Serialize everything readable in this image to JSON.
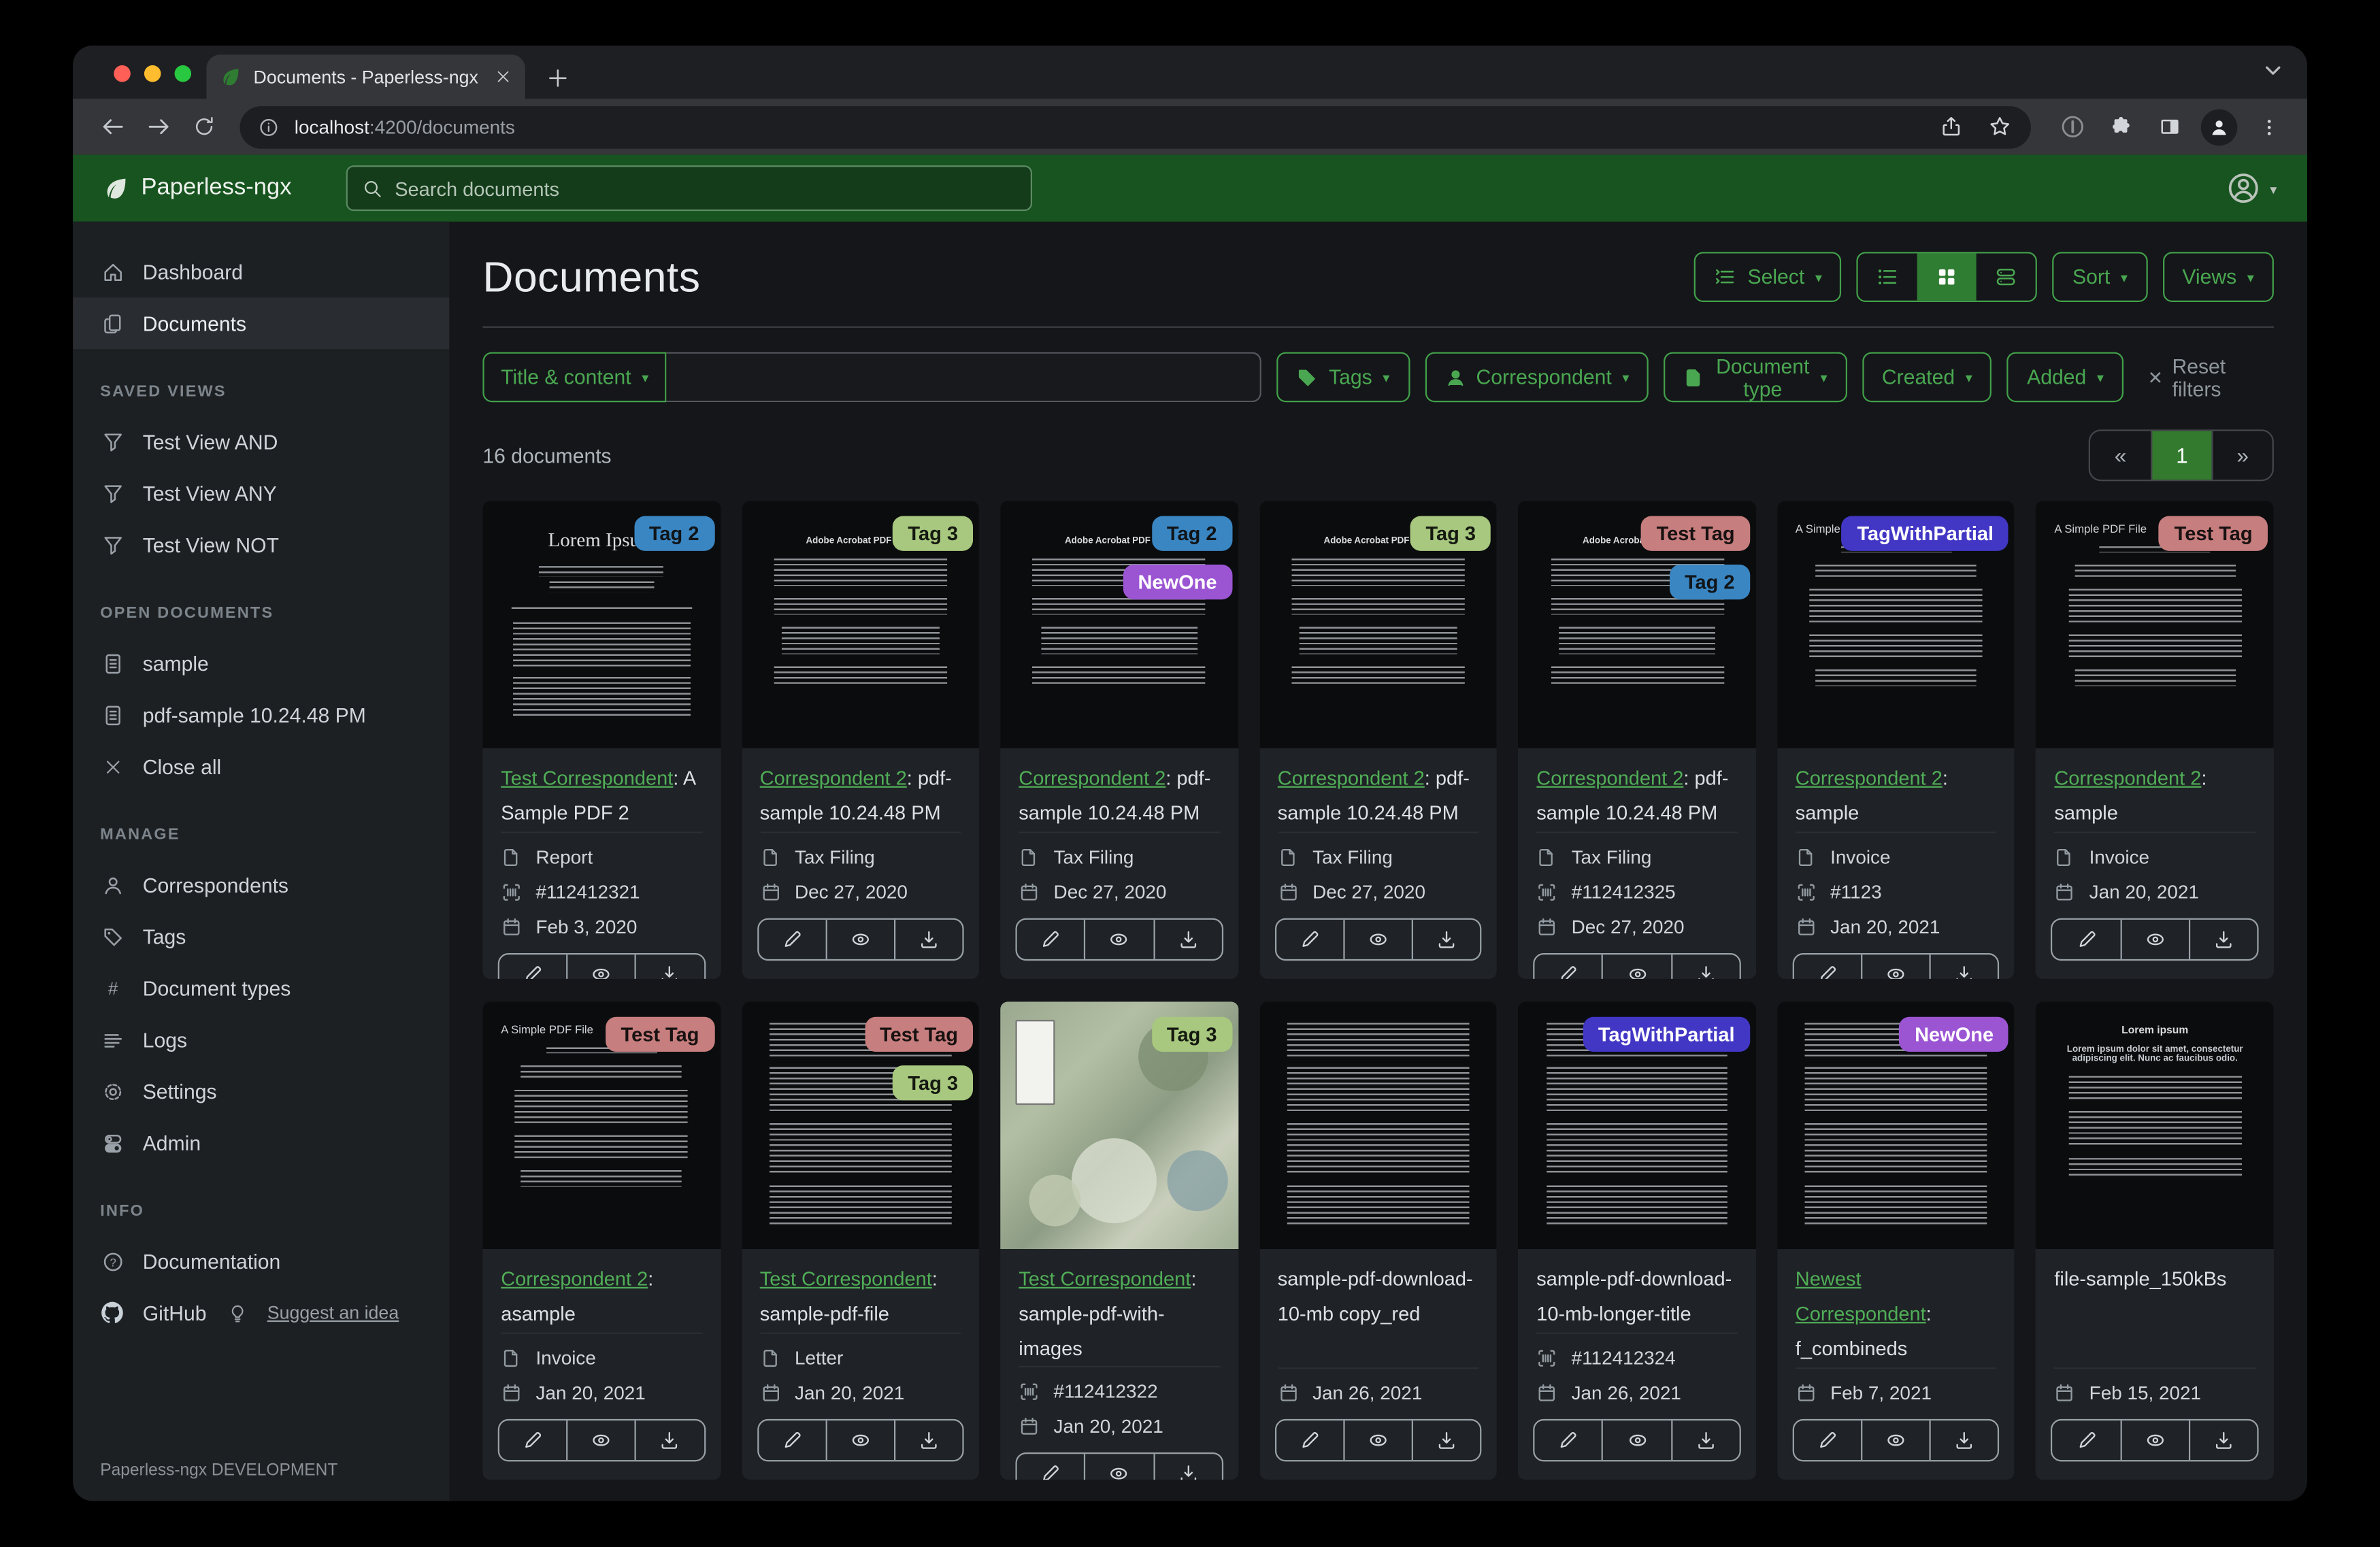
{
  "browser": {
    "tab_title": "Documents - Paperless-ngx",
    "url_host": "localhost",
    "url_path": ":4200/documents"
  },
  "header": {
    "app_name": "Paperless-ngx",
    "search_placeholder": "Search documents"
  },
  "sidebar": {
    "nav": [
      {
        "label": "Dashboard"
      },
      {
        "label": "Documents"
      }
    ],
    "saved_views_heading": "SAVED VIEWS",
    "saved_views": [
      "Test View AND",
      "Test View ANY",
      "Test View NOT"
    ],
    "open_documents_heading": "OPEN DOCUMENTS",
    "open_documents": [
      "sample",
      "pdf-sample 10.24.48 PM"
    ],
    "close_all": "Close all",
    "manage_heading": "MANAGE",
    "manage": [
      "Correspondents",
      "Tags",
      "Document types",
      "Logs",
      "Settings",
      "Admin"
    ],
    "info_heading": "INFO",
    "documentation": "Documentation",
    "github": "GitHub",
    "suggest_idea": "Suggest an idea",
    "footer": "Paperless-ngx DEVELOPMENT"
  },
  "page": {
    "title": "Documents",
    "select_label": "Select",
    "sort_label": "Sort",
    "views_label": "Views",
    "count": "16 documents",
    "pagination": [
      "«",
      "1",
      "»"
    ]
  },
  "filters": {
    "field_label": "Title & content",
    "buttons": [
      "Tags",
      "Correspondent",
      "Document type",
      "Created",
      "Added"
    ],
    "reset_label": "Reset filters"
  },
  "tag_palette": {
    "Tag 2": {
      "bg": "#3a86c3",
      "fg": "#101417"
    },
    "Tag 3": {
      "bg": "#a7c87e",
      "fg": "#141810"
    },
    "Test Tag": {
      "bg": "#c77e7e",
      "fg": "#181111"
    },
    "NewOne": {
      "bg": "#9b55d3",
      "fg": "#ffffff"
    },
    "TagWithPartial": {
      "bg": "#4237c4",
      "fg": "#ffffff"
    }
  },
  "accent_colors": {
    "header_green": "#17541f",
    "button_green": "#42a04a",
    "active_green": "#2f7d33"
  },
  "documents": [
    {
      "tags": [
        "Tag 2"
      ],
      "preview": {
        "kind": "serif",
        "header": "Lorem Ipsum"
      },
      "correspondent": "Test Correspondent",
      "title_rest": ": A Sample PDF 2",
      "type": "Report",
      "asn": "#112412321",
      "date": "Feb 3, 2020"
    },
    {
      "tags": [
        "Tag 3"
      ],
      "preview": {
        "kind": "acrobat",
        "header": "Adobe Acrobat PDF Files"
      },
      "correspondent": "Correspondent 2",
      "title_rest": ": pdf-sample 10.24.48 PM",
      "type": "Tax Filing",
      "asn": null,
      "date": "Dec 27, 2020"
    },
    {
      "tags": [
        "Tag 2",
        "NewOne"
      ],
      "preview": {
        "kind": "acrobat",
        "header": "Adobe Acrobat PDF Files"
      },
      "correspondent": "Correspondent 2",
      "title_rest": ": pdf-sample 10.24.48 PM",
      "type": "Tax Filing",
      "asn": null,
      "date": "Dec 27, 2020"
    },
    {
      "tags": [
        "Tag 3"
      ],
      "preview": {
        "kind": "acrobat",
        "header": "Adobe Acrobat PDF Files"
      },
      "correspondent": "Correspondent 2",
      "title_rest": ": pdf-sample 10.24.48 PM",
      "type": "Tax Filing",
      "asn": null,
      "date": "Dec 27, 2020"
    },
    {
      "tags": [
        "Test Tag",
        "Tag 2"
      ],
      "preview": {
        "kind": "acrobat",
        "header": "Adobe Acrobat PDF Files"
      },
      "correspondent": "Correspondent 2",
      "title_rest": ": pdf-sample 10.24.48 PM",
      "type": "Tax Filing",
      "asn": "#112412325",
      "date": "Dec 27, 2020"
    },
    {
      "tags": [
        "TagWithPartial"
      ],
      "preview": {
        "kind": "simple",
        "header": "A Simple PDF File"
      },
      "correspondent": "Correspondent 2",
      "title_rest": ": sample",
      "type": "Invoice",
      "asn": "#1123",
      "date": "Jan 20, 2021"
    },
    {
      "tags": [
        "Test Tag"
      ],
      "preview": {
        "kind": "simple",
        "header": "A Simple PDF File"
      },
      "correspondent": "Correspondent 2",
      "title_rest": ": sample",
      "type": "Invoice",
      "asn": null,
      "date": "Jan 20, 2021"
    },
    {
      "tags": [
        "Test Tag"
      ],
      "preview": {
        "kind": "simple",
        "header": "A Simple PDF File"
      },
      "correspondent": "Correspondent 2",
      "title_rest": ": asample",
      "type": "Invoice",
      "asn": null,
      "date": "Jan 20, 2021"
    },
    {
      "tags": [
        "Test Tag",
        "Tag 3"
      ],
      "preview": {
        "kind": "plain",
        "header": null
      },
      "correspondent": "Test Correspondent",
      "title_rest": ": sample-pdf-file",
      "type": "Letter",
      "asn": null,
      "date": "Jan 20, 2021"
    },
    {
      "tags": [
        "Tag 3"
      ],
      "preview": {
        "kind": "map",
        "header": null
      },
      "correspondent": "Test Correspondent",
      "title_rest": ": sample-pdf-with-images",
      "type": null,
      "asn": "#112412322",
      "date": "Jan 20, 2021"
    },
    {
      "tags": [],
      "preview": {
        "kind": "plain",
        "header": null
      },
      "correspondent": null,
      "title_rest": "sample-pdf-download-10-mb copy_red",
      "type": null,
      "asn": null,
      "date": "Jan 26, 2021"
    },
    {
      "tags": [
        "TagWithPartial"
      ],
      "preview": {
        "kind": "plain",
        "header": null
      },
      "correspondent": null,
      "title_rest": "sample-pdf-download-10-mb-longer-title",
      "type": null,
      "asn": "#112412324",
      "date": "Jan 26, 2021"
    },
    {
      "tags": [
        "NewOne"
      ],
      "preview": {
        "kind": "plain",
        "header": null
      },
      "correspondent": "Newest Correspondent",
      "title_rest": ": f_combineds",
      "type": null,
      "asn": null,
      "date": "Feb 7, 2021"
    },
    {
      "tags": [],
      "preview": {
        "kind": "center",
        "header": "Lorem ipsum",
        "sub": "Lorem ipsum dolor sit amet, consectetur adipiscing elit. Nunc ac faucibus odio."
      },
      "correspondent": null,
      "title_rest": "file-sample_150kBs",
      "type": null,
      "asn": null,
      "date": "Feb 15, 2021"
    }
  ]
}
